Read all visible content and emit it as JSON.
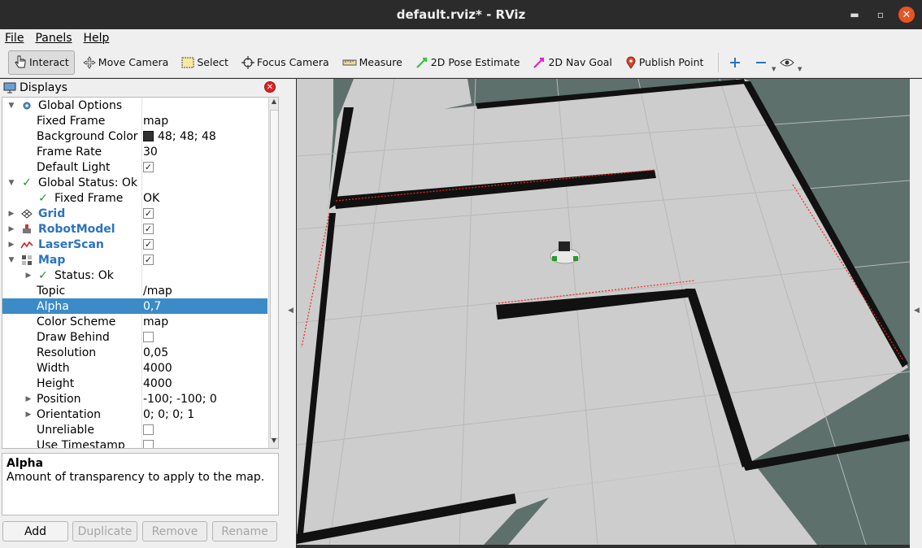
{
  "window": {
    "title": "default.rviz* - RViz"
  },
  "menu": {
    "items": [
      "File",
      "Panels",
      "Help"
    ]
  },
  "toolbar": {
    "tools": [
      {
        "label": "Interact",
        "icon": "hand-pointer-icon",
        "active": true
      },
      {
        "label": "Move Camera",
        "icon": "move-camera-icon"
      },
      {
        "label": "Select",
        "icon": "select-box-icon"
      },
      {
        "label": "Focus Camera",
        "icon": "focus-camera-icon"
      },
      {
        "label": "Measure",
        "icon": "ruler-icon"
      },
      {
        "label": "2D Pose Estimate",
        "icon": "green-arrow-icon"
      },
      {
        "label": "2D Nav Goal",
        "icon": "magenta-arrow-icon"
      },
      {
        "label": "Publish Point",
        "icon": "map-pin-icon"
      }
    ],
    "extra_icons": [
      "plus-icon",
      "minus-icon",
      "eye-icon"
    ]
  },
  "displays_panel": {
    "title": "Displays",
    "rows": [
      {
        "name": "Global Options",
        "value": "",
        "level": 0,
        "expand": "open",
        "icon": "gear-icon"
      },
      {
        "name": "Fixed Frame",
        "value": "map",
        "level": 1
      },
      {
        "name": "Background Color",
        "value": "48; 48; 48",
        "level": 1,
        "swatch": "#303030"
      },
      {
        "name": "Frame Rate",
        "value": "30",
        "level": 1
      },
      {
        "name": "Default Light",
        "value": "",
        "level": 1,
        "checkbox": true
      },
      {
        "name": "Global Status: Ok",
        "value": "",
        "level": 0,
        "expand": "open",
        "icon": "check-icon"
      },
      {
        "name": "Fixed Frame",
        "value": "OK",
        "level": 1,
        "icon": "check-icon"
      },
      {
        "name": "Grid",
        "value": "",
        "level": 0,
        "expand": "closed",
        "icon": "grid-icon",
        "blue": true,
        "checkbox": true
      },
      {
        "name": "RobotModel",
        "value": "",
        "level": 0,
        "expand": "closed",
        "icon": "robot-icon",
        "blue": true,
        "checkbox": true
      },
      {
        "name": "LaserScan",
        "value": "",
        "level": 0,
        "expand": "closed",
        "icon": "laser-icon",
        "blue": true,
        "checkbox": true
      },
      {
        "name": "Map",
        "value": "",
        "level": 0,
        "expand": "open",
        "icon": "map-icon",
        "blue": true,
        "checkbox": true
      },
      {
        "name": "Status: Ok",
        "value": "",
        "level": 1,
        "expand": "closed",
        "icon": "check-icon"
      },
      {
        "name": "Topic",
        "value": "/map",
        "level": 1
      },
      {
        "name": "Alpha",
        "value": "0,7",
        "level": 1,
        "selected": true
      },
      {
        "name": "Color Scheme",
        "value": "map",
        "level": 1
      },
      {
        "name": "Draw Behind",
        "value": "",
        "level": 1,
        "checkbox": false
      },
      {
        "name": "Resolution",
        "value": "0,05",
        "level": 1
      },
      {
        "name": "Width",
        "value": "4000",
        "level": 1
      },
      {
        "name": "Height",
        "value": "4000",
        "level": 1
      },
      {
        "name": "Position",
        "value": "-100; -100; 0",
        "level": 1,
        "expand": "closed"
      },
      {
        "name": "Orientation",
        "value": "0; 0; 0; 1",
        "level": 1,
        "expand": "closed"
      },
      {
        "name": "Unreliable",
        "value": "",
        "level": 1,
        "checkbox": false
      },
      {
        "name": "Use Timestamp",
        "value": "",
        "level": 1,
        "checkbox": false
      }
    ],
    "description": {
      "title": "Alpha",
      "text": "Amount of transparency to apply to the map."
    },
    "buttons": [
      {
        "label": "Add",
        "enabled": true
      },
      {
        "label": "Duplicate",
        "enabled": false
      },
      {
        "label": "Remove",
        "enabled": false
      },
      {
        "label": "Rename",
        "enabled": false
      }
    ]
  },
  "colors": {
    "titlebar": "#2b2b2b",
    "close": "#e95420",
    "selection": "#3a8bc8",
    "background": "#303030",
    "unknown_space": "#5d706c",
    "free_space": "#cdcdcd",
    "wall": "#111111",
    "laser": "#ff2020"
  }
}
